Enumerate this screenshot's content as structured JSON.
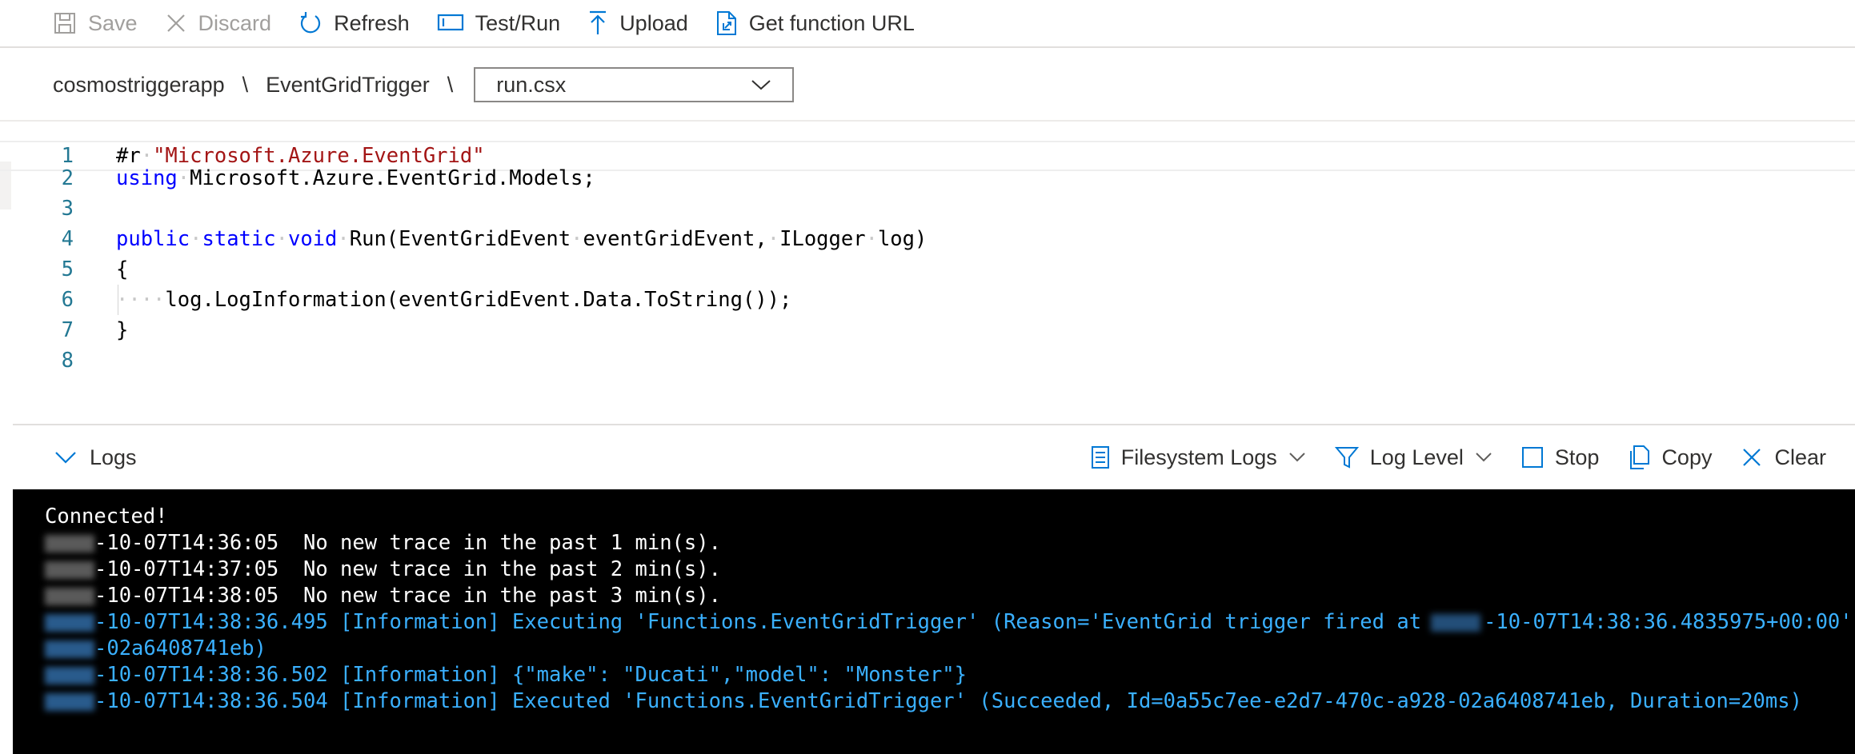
{
  "toolbar": {
    "save_label": "Save",
    "discard_label": "Discard",
    "refresh_label": "Refresh",
    "testrun_label": "Test/Run",
    "upload_label": "Upload",
    "get_url_label": "Get function URL"
  },
  "breadcrumb": {
    "app": "cosmostriggerapp",
    "function": "EventGridTrigger",
    "separator": "\\",
    "file_selected": "run.csx"
  },
  "editor": {
    "lines": [
      {
        "num": "1",
        "p1": "#r",
        "p2": " ",
        "p3": "\"Microsoft.Azure.EventGrid\""
      },
      {
        "num": "2",
        "p1": "using",
        "p2": " ",
        "p3": "Microsoft.Azure.EventGrid.Models;"
      },
      {
        "num": "3"
      },
      {
        "num": "4",
        "k1": "public",
        "k2": "static",
        "k3": "void",
        "rest1": "Run(EventGridEvent",
        "rest2": "eventGridEvent,",
        "rest3": "ILogger",
        "rest4": "log)"
      },
      {
        "num": "5",
        "text": "{"
      },
      {
        "num": "6",
        "dots": "····",
        "text": "log.LogInformation(eventGridEvent.Data.ToString());"
      },
      {
        "num": "7",
        "text": "}"
      },
      {
        "num": "8"
      }
    ],
    "space_dot": "·"
  },
  "logs": {
    "title": "Logs",
    "filesystem_label": "Filesystem Logs",
    "loglevel_label": "Log Level",
    "stop_label": "Stop",
    "copy_label": "Copy",
    "clear_label": "Clear"
  },
  "console": {
    "connected": "Connected!",
    "lines": [
      {
        "text": "-10-07T14:36:05  No new trace in the past 1 min(s)."
      },
      {
        "text": "-10-07T14:37:05  No new trace in the past 2 min(s)."
      },
      {
        "text": "-10-07T14:38:05  No new trace in the past 3 min(s)."
      },
      {
        "text": "-10-07T14:38:36.495 [Information] Executing 'Functions.EventGridTrigger' (Reason='EventGrid trigger fired at",
        "text_b": "-10-07T14:38:36.4835975+00:00'"
      },
      {
        "text": "-02a6408741eb)"
      },
      {
        "text": "-10-07T14:38:36.502 [Information] {\"make\": \"Ducati\",\"model\": \"Monster\"}"
      },
      {
        "text": "-10-07T14:38:36.504 [Information] Executed 'Functions.EventGridTrigger' (Succeeded, Id=0a55c7ee-e2d7-470c-a928-02a6408741eb, Duration=20ms)"
      }
    ]
  },
  "colors": {
    "line_number": "#237893",
    "keyword": "#0000ff",
    "string": "#a31515",
    "console_bg": "#000000",
    "console_info": "#3ab0ff"
  }
}
